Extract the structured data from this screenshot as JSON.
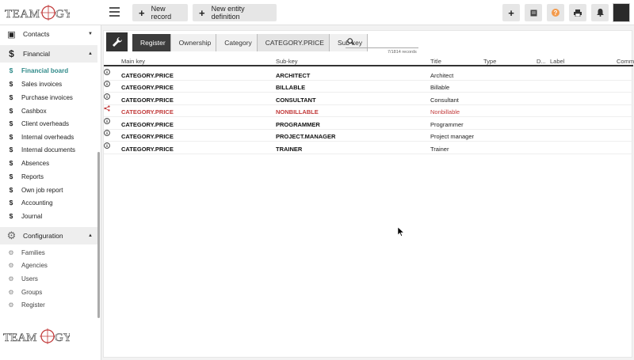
{
  "app": {
    "logo_text": "TEAMOGY"
  },
  "topbar": {
    "new_record_label": "New record",
    "new_entity_label": "New entity definition",
    "icons": [
      "plus-icon",
      "notes-icon",
      "help-icon",
      "print-icon",
      "bell-icon"
    ],
    "help_color": "#f39a4b"
  },
  "sidebar": {
    "contacts_label": "Contacts",
    "financial_label": "Financial",
    "financial_items": [
      {
        "label": "Financial board",
        "active": true
      },
      {
        "label": "Sales invoices"
      },
      {
        "label": "Purchase invoices"
      },
      {
        "label": "Cashbox"
      },
      {
        "label": "Client overheads"
      },
      {
        "label": "Internal overheads"
      },
      {
        "label": "Internal documents"
      },
      {
        "label": "Absences"
      },
      {
        "label": "Reports"
      },
      {
        "label": "Own job report"
      },
      {
        "label": "Accounting"
      },
      {
        "label": "Journal"
      }
    ],
    "configuration_label": "Configuration",
    "configuration_items": [
      {
        "label": "Families"
      },
      {
        "label": "Agencies"
      },
      {
        "label": "Users"
      },
      {
        "label": "Groups"
      },
      {
        "label": "Register"
      }
    ],
    "active_color": "#2f8a89"
  },
  "breadcrumb": {
    "items": [
      "Register",
      "Ownership",
      "Category",
      "CATEGORY.PRICE",
      "Sub-key"
    ]
  },
  "search": {
    "placeholder": "",
    "value": "",
    "records": "7/1814 records"
  },
  "table": {
    "columns": [
      "Main key",
      "Sub-key",
      "Title",
      "Type",
      "D...",
      "Label",
      "Comm"
    ],
    "rows": [
      {
        "main_key": "CATEGORY.PRICE",
        "sub_key": "ARCHITECT",
        "title": "Architect",
        "icon": "info-icon"
      },
      {
        "main_key": "CATEGORY.PRICE",
        "sub_key": "BILLABLE",
        "title": "Billable",
        "icon": "info-icon"
      },
      {
        "main_key": "CATEGORY.PRICE",
        "sub_key": "CONSULTANT",
        "title": "Consultant",
        "icon": "info-icon"
      },
      {
        "main_key": "CATEGORY.PRICE",
        "sub_key": "NONBILLABLE",
        "title": "Nonbillable",
        "icon": "share-icon",
        "highlighted": true
      },
      {
        "main_key": "CATEGORY.PRICE",
        "sub_key": "PROGRAMMER",
        "title": "Programmer",
        "icon": "info-icon"
      },
      {
        "main_key": "CATEGORY.PRICE",
        "sub_key": "PROJECT.MANAGER",
        "title": "Project manager",
        "icon": "info-icon"
      },
      {
        "main_key": "CATEGORY.PRICE",
        "sub_key": "TRAINER",
        "title": "Trainer",
        "icon": "info-icon"
      }
    ],
    "highlight_color": "#c23b3b"
  }
}
